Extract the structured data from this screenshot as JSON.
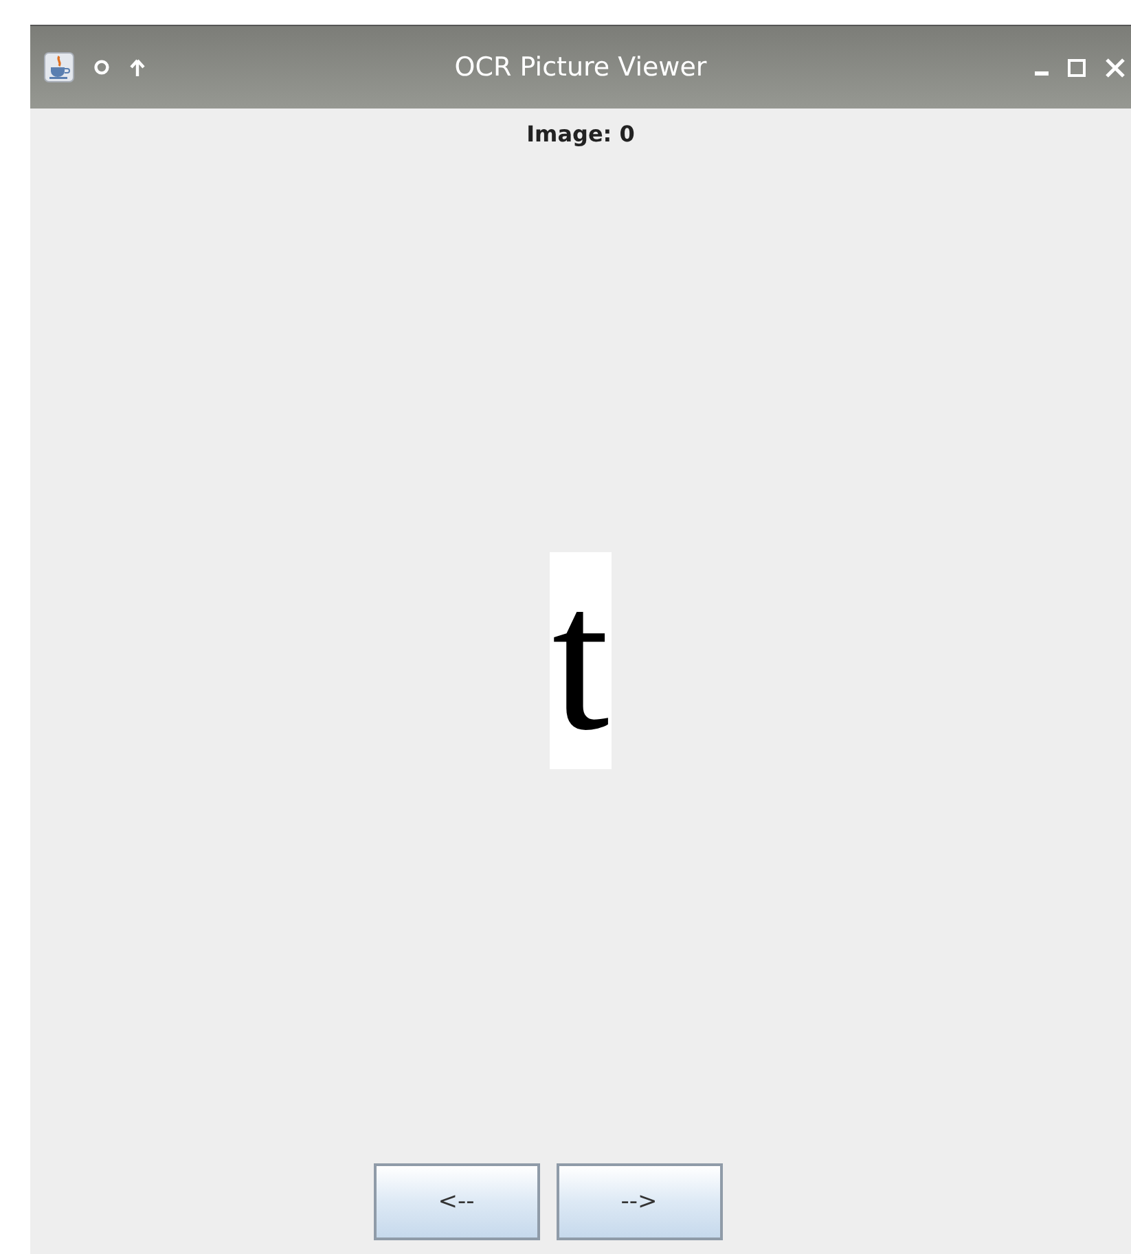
{
  "window": {
    "title": "OCR Picture Viewer"
  },
  "header": "Image: 0",
  "image": {
    "glyph": "t"
  },
  "buttons": [
    {
      "label": "<--"
    },
    {
      "label": "-->"
    }
  ]
}
